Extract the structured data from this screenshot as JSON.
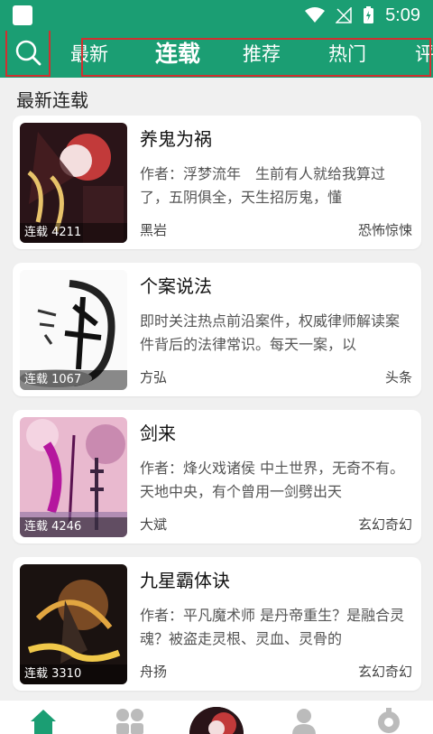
{
  "status_bar": {
    "time": "5:09"
  },
  "nav": {
    "tabs": [
      "最新",
      "连载",
      "推荐",
      "热门",
      "评"
    ],
    "active": "连载"
  },
  "section": {
    "title": "最新连载"
  },
  "books": [
    {
      "title": "养鬼为祸",
      "desc": "作者：浮梦流年　生前有人就给我算过了，五阴俱全，天生招厉鬼，懂",
      "author": "黑岩",
      "genre": "恐怖惊悚",
      "badge": "连载 4211"
    },
    {
      "title": "个案说法",
      "desc": "即时关注热点前沿案件，权威律师解读案件背后的法律常识。每天一案，以",
      "author": "方弘",
      "genre": "头条",
      "badge": "连载 1067"
    },
    {
      "title": "剑来",
      "desc": "作者：烽火戏诸侯 中土世界，无奇不有。天地中央，有个曾用一剑劈出天",
      "author": "大斌",
      "genre": "玄幻奇幻",
      "badge": "连载 4246"
    },
    {
      "title": "九星霸体诀",
      "desc": "作者：平凡魔术师 是丹帝重生？是融合灵魂？被盗走灵根、灵血、灵骨的",
      "author": "舟扬",
      "genre": "玄幻奇幻",
      "badge": "连载 3310"
    }
  ],
  "colors": {
    "brand": "#1b9e73",
    "highlight": "#d03030"
  },
  "bottom_nav": {
    "icons": [
      "home-icon",
      "grid-icon",
      "avatar",
      "person-icon",
      "settings-icon"
    ]
  }
}
